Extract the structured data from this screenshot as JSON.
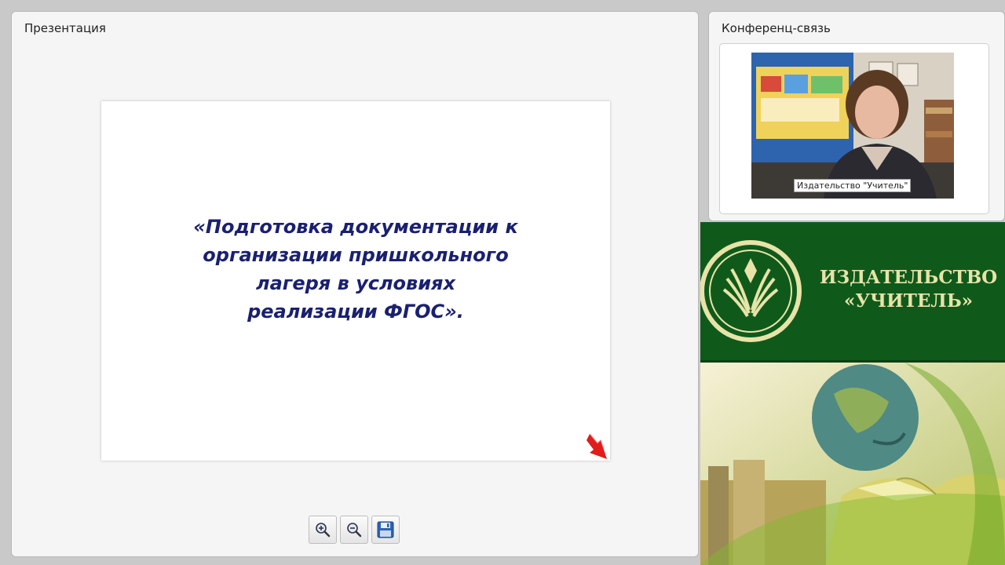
{
  "presentation": {
    "title": "Презентация",
    "slide_lines": [
      "«Подготовка документации к",
      "организации пришкольного",
      "лагеря в условиях",
      "реализации ФГОС»."
    ],
    "toolbar": [
      {
        "name": "zoom-in",
        "icon": "zoom-in-icon"
      },
      {
        "name": "zoom-out",
        "icon": "zoom-out-icon"
      },
      {
        "name": "save",
        "icon": "floppy-disk-icon"
      }
    ]
  },
  "conference": {
    "title": "Конференц-связь",
    "participant_label": "Издательство \"Учитель\""
  },
  "banner": {
    "publisher_line1": "ИЗДАТЕЛЬСТВО",
    "publisher_line2": "«УЧИТЕЛЬ»"
  },
  "colors": {
    "slide_text": "#1a2070",
    "banner_green": "#0f5a1b",
    "banner_text": "#e8e3a8"
  }
}
